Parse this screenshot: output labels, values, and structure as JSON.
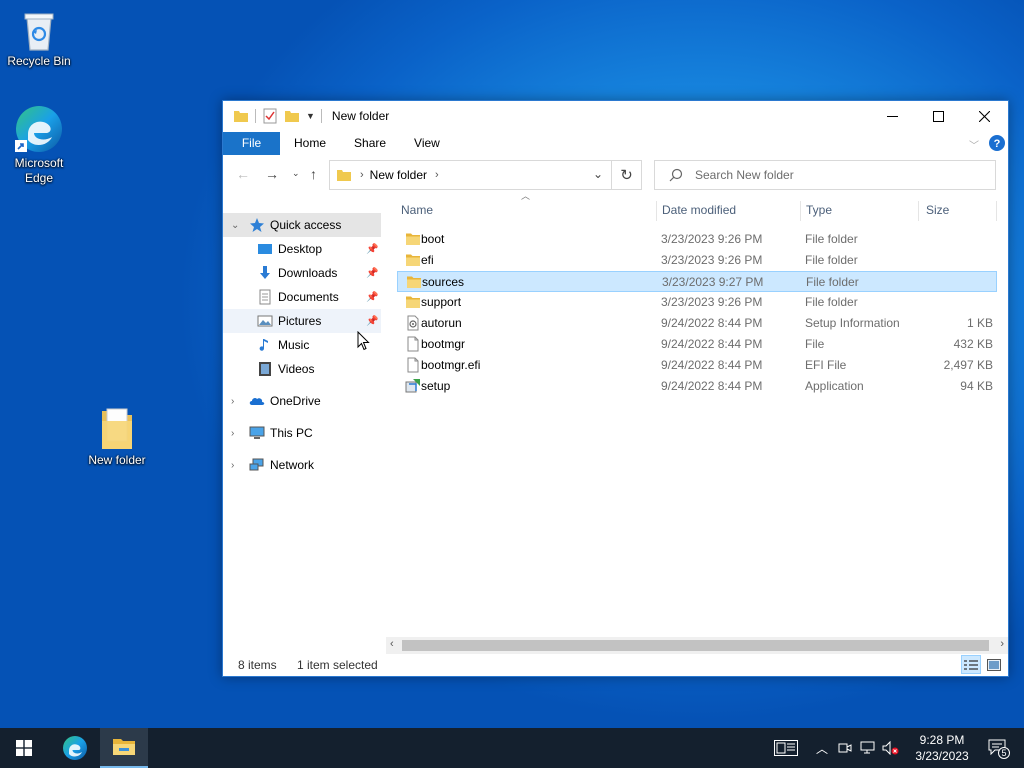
{
  "desktop": {
    "icons": [
      {
        "label": "Recycle Bin"
      },
      {
        "label": "Microsoft Edge"
      },
      {
        "label": "New folder"
      }
    ]
  },
  "window": {
    "title": "New folder",
    "ribbon_tabs": [
      "File",
      "Home",
      "Share",
      "View"
    ],
    "address": {
      "segments": [
        "New folder"
      ]
    },
    "search": {
      "placeholder": "Search New folder"
    }
  },
  "nav_pane": {
    "quick_access": "Quick access",
    "quick_items": [
      {
        "label": "Desktop",
        "icon": "desktop-icon"
      },
      {
        "label": "Downloads",
        "icon": "downloads-icon"
      },
      {
        "label": "Documents",
        "icon": "documents-icon"
      },
      {
        "label": "Pictures",
        "icon": "pictures-icon"
      },
      {
        "label": "Music",
        "icon": "music-icon"
      },
      {
        "label": "Videos",
        "icon": "videos-icon"
      }
    ],
    "roots": [
      {
        "label": "OneDrive",
        "icon": "onedrive-icon"
      },
      {
        "label": "This PC",
        "icon": "this-pc-icon"
      },
      {
        "label": "Network",
        "icon": "network-icon"
      }
    ]
  },
  "file_list": {
    "columns": [
      "Name",
      "Date modified",
      "Type",
      "Size"
    ],
    "rows": [
      {
        "name": "boot",
        "date": "3/23/2023 9:26 PM",
        "type": "File folder",
        "size": "",
        "icon": "folder-icon"
      },
      {
        "name": "efi",
        "date": "3/23/2023 9:26 PM",
        "type": "File folder",
        "size": "",
        "icon": "folder-icon"
      },
      {
        "name": "sources",
        "date": "3/23/2023 9:27 PM",
        "type": "File folder",
        "size": "",
        "icon": "folder-icon",
        "selected": true
      },
      {
        "name": "support",
        "date": "3/23/2023 9:26 PM",
        "type": "File folder",
        "size": "",
        "icon": "folder-icon"
      },
      {
        "name": "autorun",
        "date": "9/24/2022 8:44 PM",
        "type": "Setup Information",
        "size": "1 KB",
        "icon": "setup-info-icon"
      },
      {
        "name": "bootmgr",
        "date": "9/24/2022 8:44 PM",
        "type": "File",
        "size": "432 KB",
        "icon": "file-icon"
      },
      {
        "name": "bootmgr.efi",
        "date": "9/24/2022 8:44 PM",
        "type": "EFI File",
        "size": "2,497 KB",
        "icon": "file-icon"
      },
      {
        "name": "setup",
        "date": "9/24/2022 8:44 PM",
        "type": "Application",
        "size": "94 KB",
        "icon": "setup-app-icon"
      }
    ]
  },
  "status_bar": {
    "item_count": "8 items",
    "selection": "1 item selected"
  },
  "taskbar": {
    "time": "9:28 PM",
    "date": "3/23/2023",
    "notification_count": "5"
  }
}
